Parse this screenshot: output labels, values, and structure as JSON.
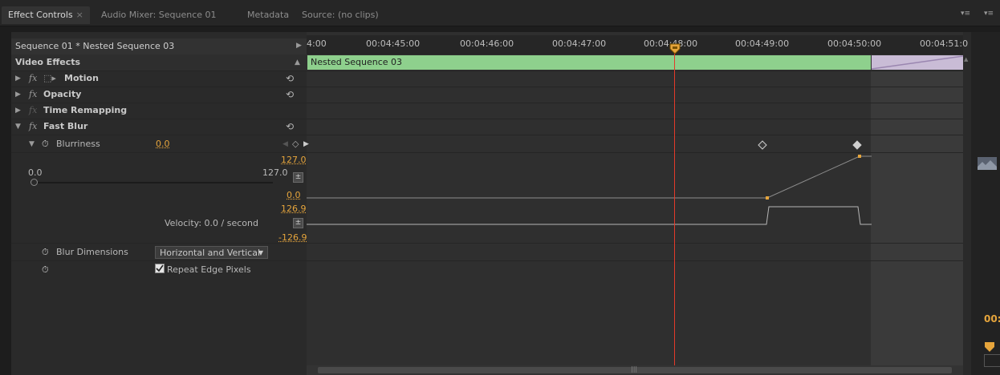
{
  "tabs": [
    {
      "label": "Effect Controls",
      "close": "×",
      "active": true
    },
    {
      "label": "Audio Mixer: Sequence 01"
    },
    {
      "label": "Metadata"
    },
    {
      "label": "Source: (no clips)"
    }
  ],
  "header": {
    "sequence_label": "Sequence 01 * Nested Sequence 03"
  },
  "ruler": {
    "ticks": [
      "4:00",
      "00:04:45:00",
      "00:04:46:00",
      "00:04:47:00",
      "00:04:48:00",
      "00:04:49:00",
      "00:04:50:00",
      "00:04:51:0"
    ]
  },
  "clip": {
    "name": "Nested Sequence 03"
  },
  "effects": {
    "section_title": "Video Effects",
    "items": [
      {
        "name": "Motion"
      },
      {
        "name": "Opacity"
      },
      {
        "name": "Time Remapping"
      },
      {
        "name": "Fast Blur"
      }
    ]
  },
  "blurriness": {
    "label": "Blurriness",
    "value": "0.0",
    "graph_max": "127.0",
    "slider_min": "0.0",
    "slider_max": "127.0",
    "graph_min": "0.0",
    "velocity_max": "126.9",
    "velocity_label": "Velocity: 0.0 / second",
    "velocity_min": "-126.9"
  },
  "blur_dimensions": {
    "label": "Blur Dimensions",
    "value": "Horizontal and Vertical"
  },
  "repeat_edge": {
    "label": "Repeat Edge Pixels"
  },
  "colors": {
    "clip_bar": "#8ed08d",
    "playhead": "#e43a2a",
    "keyframe_value": "#e6a53c"
  },
  "right_strip_time": "00:"
}
